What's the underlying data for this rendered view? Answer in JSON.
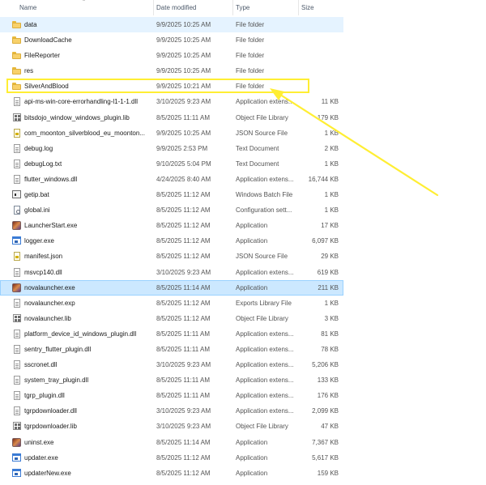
{
  "header": {
    "name": "Name",
    "date_modified": "Date modified",
    "type": "Type",
    "size": "Size"
  },
  "files": [
    {
      "name": "data",
      "date": "9/9/2025 10:25 AM",
      "type": "File folder",
      "size": "",
      "icon": "folder-icon"
    },
    {
      "name": "DownloadCache",
      "date": "9/9/2025 10:25 AM",
      "type": "File folder",
      "size": "",
      "icon": "folder-icon"
    },
    {
      "name": "FileReporter",
      "date": "9/9/2025 10:25 AM",
      "type": "File folder",
      "size": "",
      "icon": "folder-icon"
    },
    {
      "name": "res",
      "date": "9/9/2025 10:25 AM",
      "type": "File folder",
      "size": "",
      "icon": "folder-icon"
    },
    {
      "name": "SilverAndBlood",
      "date": "9/9/2025 10:21 AM",
      "type": "File folder",
      "size": "",
      "icon": "folder-icon"
    },
    {
      "name": "api-ms-win-core-errorhandling-l1-1-1.dll",
      "date": "3/10/2025 9:23 AM",
      "type": "Application extens...",
      "size": "11 KB",
      "icon": "file-icon"
    },
    {
      "name": "bitsdojo_window_windows_plugin.lib",
      "date": "8/5/2025 11:11 AM",
      "type": "Object File Library",
      "size": "179 KB",
      "icon": "library-icon"
    },
    {
      "name": "com_moonton_silverblood_eu_moonton...",
      "date": "9/9/2025 10:25 AM",
      "type": "JSON Source File",
      "size": "1 KB",
      "icon": "json-icon"
    },
    {
      "name": "debug.log",
      "date": "9/9/2025 2:53 PM",
      "type": "Text Document",
      "size": "2 KB",
      "icon": "file-icon"
    },
    {
      "name": "debugLog.txt",
      "date": "9/10/2025 5:04 PM",
      "type": "Text Document",
      "size": "1 KB",
      "icon": "file-icon"
    },
    {
      "name": "flutter_windows.dll",
      "date": "4/24/2025 8:40 AM",
      "type": "Application extens...",
      "size": "16,744 KB",
      "icon": "file-icon"
    },
    {
      "name": "getip.bat",
      "date": "8/5/2025 11:12 AM",
      "type": "Windows Batch File",
      "size": "1 KB",
      "icon": "batch-icon"
    },
    {
      "name": "global.ini",
      "date": "8/5/2025 11:12 AM",
      "type": "Configuration sett...",
      "size": "1 KB",
      "icon": "settings-icon"
    },
    {
      "name": "LauncherStart.exe",
      "date": "8/5/2025 11:12 AM",
      "type": "Application",
      "size": "17 KB",
      "icon": "app-logo-icon"
    },
    {
      "name": "logger.exe",
      "date": "8/5/2025 11:12 AM",
      "type": "Application",
      "size": "6,097 KB",
      "icon": "application-icon"
    },
    {
      "name": "manifest.json",
      "date": "8/5/2025 11:12 AM",
      "type": "JSON Source File",
      "size": "29 KB",
      "icon": "json-icon"
    },
    {
      "name": "msvcp140.dll",
      "date": "3/10/2025 9:23 AM",
      "type": "Application extens...",
      "size": "619 KB",
      "icon": "file-icon"
    },
    {
      "name": "novalauncher.exe",
      "date": "8/5/2025 11:14 AM",
      "type": "Application",
      "size": "211 KB",
      "icon": "app-logo-icon"
    },
    {
      "name": "novalauncher.exp",
      "date": "8/5/2025 11:12 AM",
      "type": "Exports Library File",
      "size": "1 KB",
      "icon": "file-icon"
    },
    {
      "name": "novalauncher.lib",
      "date": "8/5/2025 11:12 AM",
      "type": "Object File Library",
      "size": "3 KB",
      "icon": "library-icon"
    },
    {
      "name": "platform_device_id_windows_plugin.dll",
      "date": "8/5/2025 11:11 AM",
      "type": "Application extens...",
      "size": "81 KB",
      "icon": "file-icon"
    },
    {
      "name": "sentry_flutter_plugin.dll",
      "date": "8/5/2025 11:11 AM",
      "type": "Application extens...",
      "size": "78 KB",
      "icon": "file-icon"
    },
    {
      "name": "sscronet.dll",
      "date": "3/10/2025 9:23 AM",
      "type": "Application extens...",
      "size": "5,206 KB",
      "icon": "file-icon"
    },
    {
      "name": "system_tray_plugin.dll",
      "date": "8/5/2025 11:11 AM",
      "type": "Application extens...",
      "size": "133 KB",
      "icon": "file-icon"
    },
    {
      "name": "tgrp_plugin.dll",
      "date": "8/5/2025 11:11 AM",
      "type": "Application extens...",
      "size": "176 KB",
      "icon": "file-icon"
    },
    {
      "name": "tgrpdownloader.dll",
      "date": "3/10/2025 9:23 AM",
      "type": "Application extens...",
      "size": "2,099 KB",
      "icon": "file-icon"
    },
    {
      "name": "tgrpdownloader.lib",
      "date": "3/10/2025 9:23 AM",
      "type": "Object File Library",
      "size": "47 KB",
      "icon": "library-icon"
    },
    {
      "name": "uninst.exe",
      "date": "8/5/2025 11:14 AM",
      "type": "Application",
      "size": "7,367 KB",
      "icon": "app-logo-icon"
    },
    {
      "name": "updater.exe",
      "date": "8/5/2025 11:12 AM",
      "type": "Application",
      "size": "5,617 KB",
      "icon": "application-icon"
    },
    {
      "name": "updaterNew.exe",
      "date": "8/5/2025 11:12 AM",
      "type": "Application",
      "size": "159 KB",
      "icon": "application-icon"
    }
  ],
  "selected_file": "novalauncher.exe",
  "highlighted_file": "SilverAndBlood",
  "colors": {
    "selection_bg": "#cce8ff",
    "selection_border": "#99d1ff",
    "hover_bg": "#e5f3ff",
    "annotation": "#ffee33",
    "folder": "#f8d16a"
  }
}
